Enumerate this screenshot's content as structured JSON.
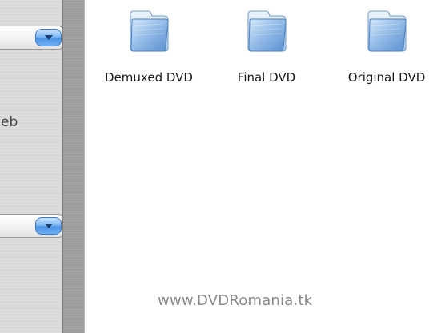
{
  "sidebar": {
    "partial_label": "eb",
    "combo_1_value": "",
    "combo_2_value": ""
  },
  "folders": [
    {
      "label": "Demuxed DVD",
      "icon": "folder-icon"
    },
    {
      "label": "Final DVD",
      "icon": "folder-icon"
    },
    {
      "label": "Original DVD",
      "icon": "folder-icon"
    }
  ],
  "watermark": "www.DVDRomania.tk",
  "colors": {
    "folder_blue": "#8fb9e6",
    "combo_button_blue": "#4a92e4",
    "divider_gray": "#9c9c9c"
  }
}
